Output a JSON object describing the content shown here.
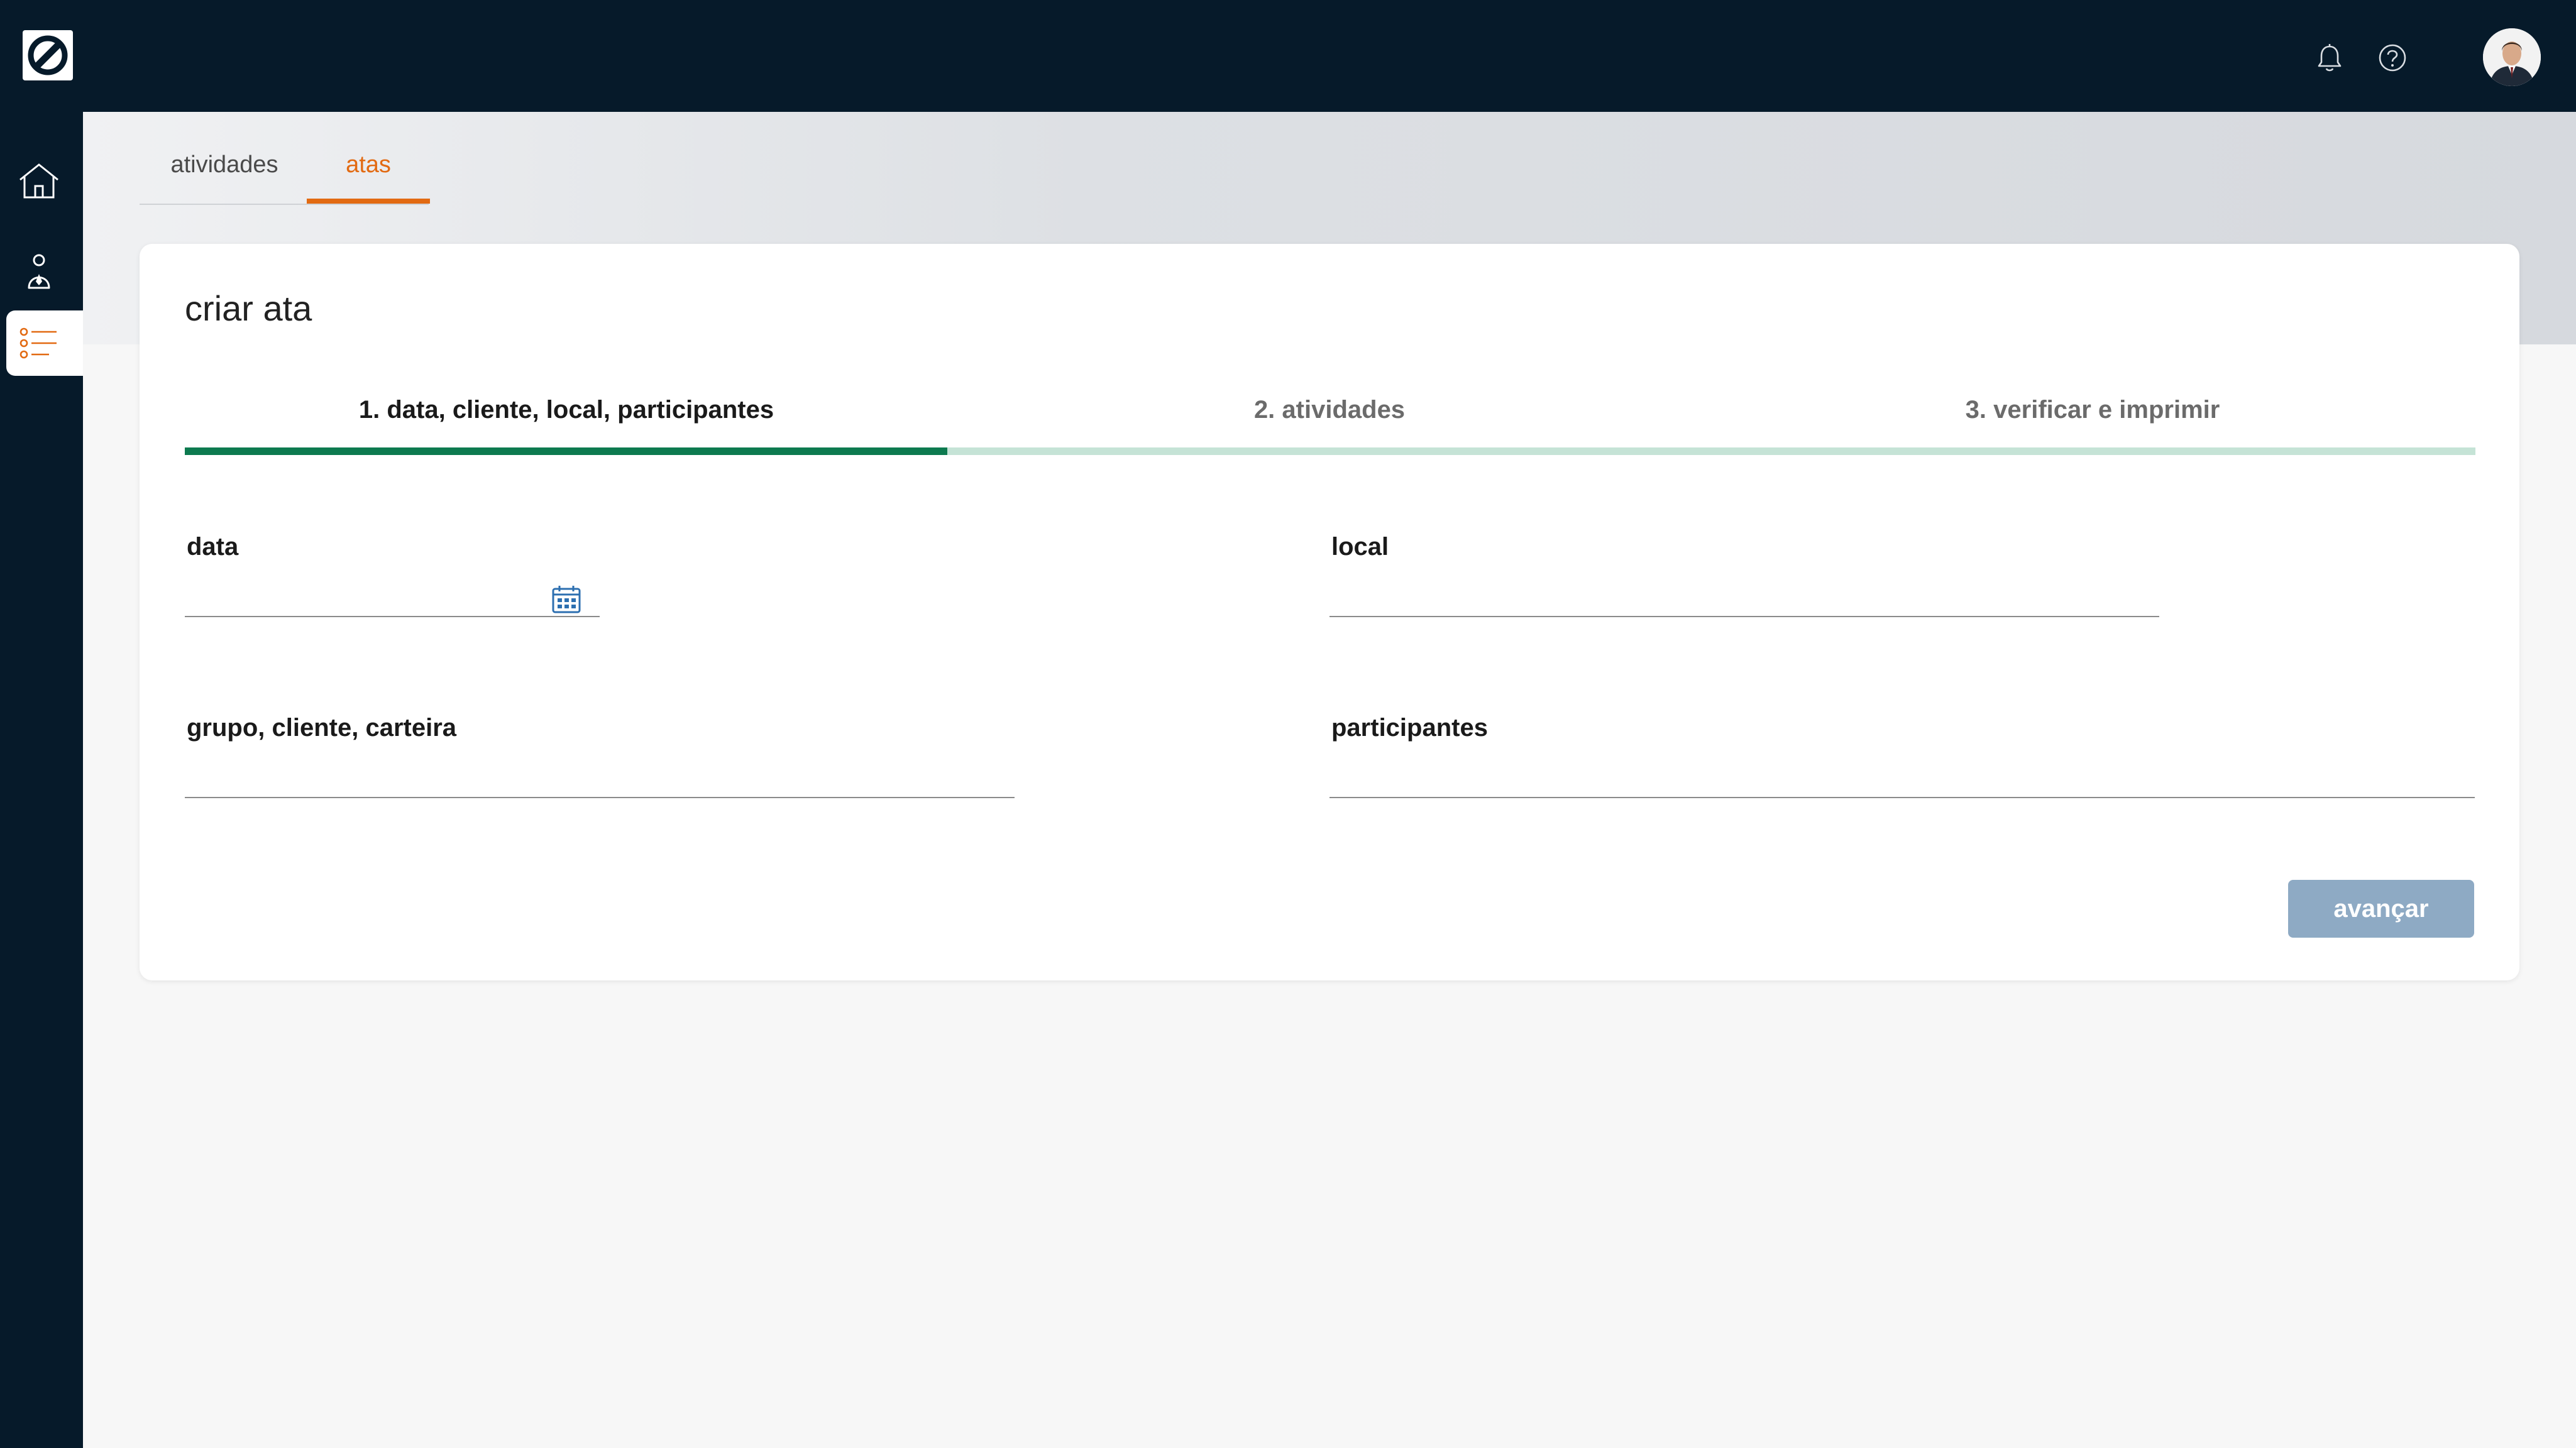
{
  "nav": {
    "tabs": [
      {
        "label": "atividades",
        "active": false
      },
      {
        "label": "atas",
        "active": true
      }
    ]
  },
  "sidebar": {
    "items": [
      {
        "name": "home-icon",
        "active": false
      },
      {
        "name": "users-icon",
        "active": false
      },
      {
        "name": "list-icon",
        "active": true
      }
    ]
  },
  "card": {
    "title": "criar ata",
    "steps": [
      {
        "label": "1. data, cliente, local, participantes",
        "active": true
      },
      {
        "label": "2. atividades",
        "active": false
      },
      {
        "label": "3. verificar e imprimir",
        "active": false
      }
    ],
    "progress_fraction": 0.333
  },
  "form": {
    "data_label": "data",
    "data_value": "",
    "local_label": "local",
    "local_value": "",
    "grupo_label": "grupo, cliente, carteira",
    "grupo_value": "",
    "participantes_label": "participantes",
    "participantes_value": ""
  },
  "actions": {
    "advance_label": "avançar"
  },
  "colors": {
    "topbar": "#061a2a",
    "accent_orange": "#e26a12",
    "progress_green": "#0d7a4f",
    "progress_track": "#c5e3d6",
    "button_disabled": "#8eaac4"
  }
}
